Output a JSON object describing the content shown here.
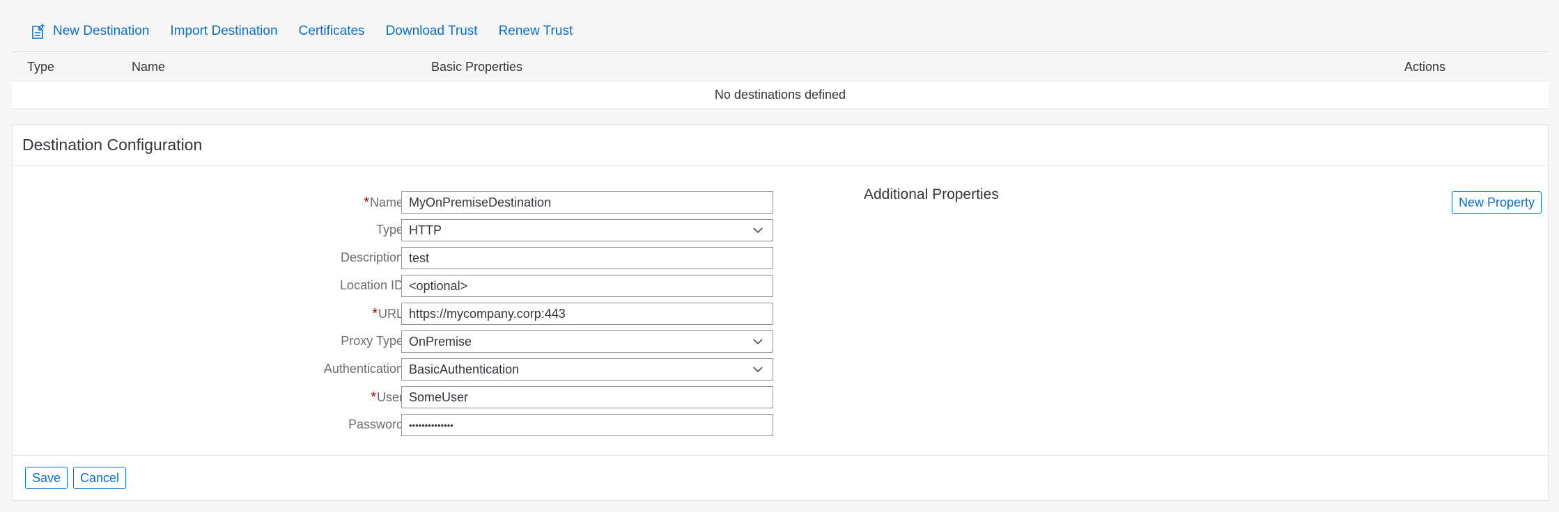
{
  "toolbar": {
    "new_destination": "New Destination",
    "import_destination": "Import Destination",
    "certificates": "Certificates",
    "download_trust": "Download Trust",
    "renew_trust": "Renew Trust"
  },
  "destinations_table": {
    "columns": [
      "Type",
      "Name",
      "Basic Properties",
      "Actions"
    ],
    "empty_message": "No destinations defined"
  },
  "destination_config": {
    "title": "Destination Configuration",
    "fields": {
      "name": {
        "label": "Name:",
        "required": true,
        "value": "MyOnPremiseDestination"
      },
      "type": {
        "label": "Type:",
        "required": false,
        "value": "HTTP"
      },
      "description": {
        "label": "Description:",
        "required": false,
        "value": "test"
      },
      "location_id": {
        "label": "Location ID:",
        "required": false,
        "value": "",
        "placeholder": "<optional>"
      },
      "url": {
        "label": "URL:",
        "required": true,
        "value": "https://mycompany.corp:443"
      },
      "proxy_type": {
        "label": "Proxy Type:",
        "required": false,
        "value": "OnPremise"
      },
      "authentication": {
        "label": "Authentication:",
        "required": false,
        "value": "BasicAuthentication"
      },
      "user": {
        "label": "User:",
        "required": true,
        "value": "SomeUser"
      },
      "password": {
        "label": "Password:",
        "required": false,
        "value": "••••••••••••••"
      }
    },
    "required_marker": "*",
    "additional_properties": "Additional Properties",
    "new_property": "New Property",
    "save": "Save",
    "cancel": "Cancel"
  },
  "colors": {
    "accent": "#0a6ed1",
    "required": "#bb0000",
    "label": "#6a6d70",
    "text": "#32363a"
  }
}
